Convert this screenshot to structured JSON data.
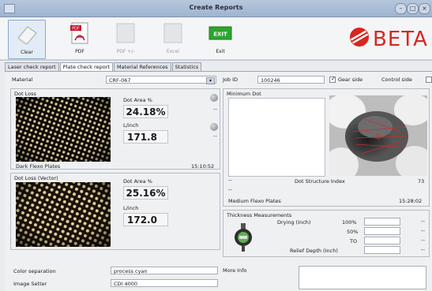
{
  "window": {
    "title": "Create Reports"
  },
  "toolbar": {
    "clear_label": "Clear",
    "pdf_label": "PDF",
    "pdf_plus_label": "PDF +/-",
    "excel_label": "Excel",
    "exit_label": "Exit",
    "exit_icon_text": "EXIT"
  },
  "logo": {
    "text": "BETA"
  },
  "tabs": [
    "Laser check report",
    "Plate check report",
    "Material References",
    "Statistics"
  ],
  "material": {
    "label": "Material",
    "value": "CRF-067"
  },
  "job": {
    "label": "Job ID",
    "value": "100246"
  },
  "side": {
    "gear_label": "Gear side",
    "gear_checked": true,
    "control_label": "Control side",
    "control_checked": false
  },
  "dot_loss": {
    "title": "Dot Loss",
    "area_label": "Dot Area %",
    "area_value": "24.18%",
    "lpi_label": "L/inch",
    "lpi_value": "171.8",
    "plate_label": "Dark Flexo Plates",
    "time": "15:10:52"
  },
  "dot_loss_vector": {
    "title": "Dot Loss (Vector)",
    "area_label": "Dot Area %",
    "area_value": "25.16%",
    "lpi_label": "L/inch",
    "lpi_value": "172.0"
  },
  "minimum_dot": {
    "title": "Minimum Dot",
    "index_label": "Dot Structure Index",
    "index_value": "73",
    "plate_label": "Medium Flexo Plates",
    "time": "15:28:02",
    "dash": "--"
  },
  "thickness": {
    "title": "Thickness Measurements",
    "drying_label": "Drying (Inch)",
    "p100": "100%",
    "p50": "50%",
    "to": "TO",
    "relief_label": "Relief Depth (Inch)",
    "dash": "--"
  },
  "color_separation": {
    "label": "Color separation",
    "value": "process cyan"
  },
  "image_setter": {
    "label": "Image Setter",
    "value": "CDI 4000"
  },
  "more_info": {
    "label": "More Info"
  },
  "dash": "--"
}
